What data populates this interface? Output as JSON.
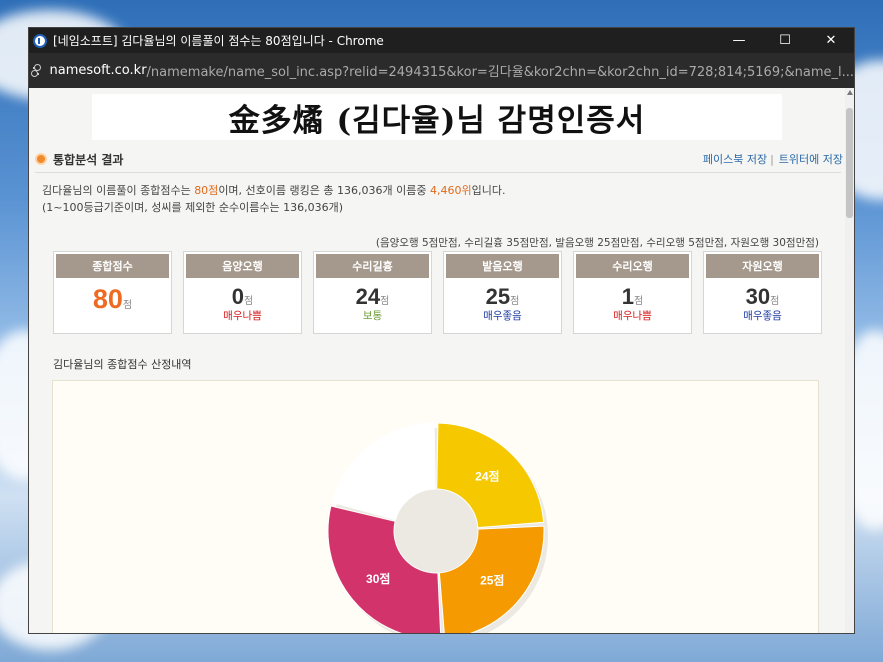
{
  "window": {
    "title": "[네임소프트] 김다율님의 이름풀이 점수는 80점입니다 - Chrome",
    "controls": {
      "minimize": "—",
      "maximize": "☐",
      "close": "✕"
    }
  },
  "url": {
    "domain": "namesoft.co.kr",
    "path": "/namemake/name_sol_inc.asp?relid=2494315&kor=김다율&kor2chn=&kor2chn_id=728;814;5169;&name_l..."
  },
  "page": {
    "certificate_title": "金多燏 (김다율)님 감명인증서",
    "section_title": "통합분석 결과",
    "share": {
      "facebook": "페이스북 저장",
      "separator": "|",
      "twitter": "트위터에 저장"
    },
    "summary": {
      "name": "김다율",
      "line1_a": "님의 이름풀이 종합점수는 ",
      "total_score": "80점",
      "line1_b": "이며, 선호이름 랭킹은 총 136,036개 이름중 ",
      "rank": "4,460위",
      "line1_c": "입니다.",
      "line2": "(1~100등급기준이며, 성씨를 제외한 순수이름수는 136,036개)"
    },
    "criteria": "(음양오행 5점만점, 수리길흉 35점만점, 발음오행 25점만점, 수리오행 5점만점, 자원오행 30점만점)",
    "cards": [
      {
        "label": "종합점수",
        "score": "80",
        "unit": "점",
        "grade": "",
        "grade_color": "none"
      },
      {
        "label": "음양오행",
        "score": "0",
        "unit": "점",
        "grade": "매우나쁨",
        "grade_color": "red"
      },
      {
        "label": "수리길흉",
        "score": "24",
        "unit": "점",
        "grade": "보통",
        "grade_color": "green"
      },
      {
        "label": "발음오행",
        "score": "25",
        "unit": "점",
        "grade": "매우좋음",
        "grade_color": "blue"
      },
      {
        "label": "수리오행",
        "score": "1",
        "unit": "점",
        "grade": "매우나쁨",
        "grade_color": "red"
      },
      {
        "label": "자원오행",
        "score": "30",
        "unit": "점",
        "grade": "매우좋음",
        "grade_color": "blue"
      }
    ],
    "breakdown_title": "김다율님의 종합점수 산정내역"
  },
  "chart_data": {
    "type": "pie",
    "subtype": "donut",
    "segments": [
      {
        "label": "24점",
        "value": 24,
        "color": "#f5c800"
      },
      {
        "label": "25점",
        "value": 25,
        "color": "#f59a00"
      },
      {
        "label": "30점",
        "value": 30,
        "color": "#d2336a"
      },
      {
        "label": "",
        "value": 21,
        "color": "#ffffff"
      }
    ]
  }
}
